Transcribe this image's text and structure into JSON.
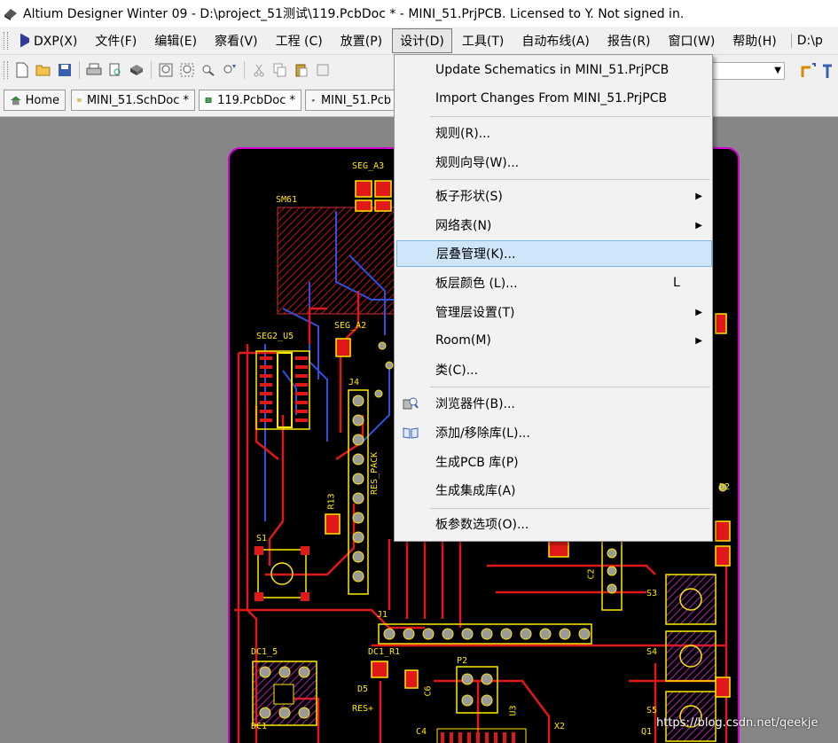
{
  "window": {
    "title": "Altium Designer Winter 09 - D:\\project_51测试\\119.PcbDoc * - MINI_51.PrjPCB. Licensed to Y. Not signed in."
  },
  "menubar": {
    "items": [
      {
        "label": "DXP(X)"
      },
      {
        "label": "文件(F)"
      },
      {
        "label": "编辑(E)"
      },
      {
        "label": "察看(V)"
      },
      {
        "label": "工程 (C)"
      },
      {
        "label": "放置(P)"
      },
      {
        "label": "设计(D)"
      },
      {
        "label": "工具(T)"
      },
      {
        "label": "自动布线(A)"
      },
      {
        "label": "报告(R)"
      },
      {
        "label": "窗口(W)"
      },
      {
        "label": "帮助(H)"
      }
    ],
    "address": "D:\\p"
  },
  "doc_tabs": [
    {
      "label": "Home"
    },
    {
      "label": "MINI_51.SchDoc *"
    },
    {
      "label": "119.PcbDoc *"
    },
    {
      "label": "MINI_51.Pcb"
    }
  ],
  "design_menu": {
    "items": [
      {
        "label": "Update Schematics in MINI_51.PrjPCB"
      },
      {
        "label": "Import Changes From MINI_51.PrjPCB"
      },
      {
        "label": "规则(R)..."
      },
      {
        "label": "规则向导(W)..."
      },
      {
        "label": "板子形状(S)"
      },
      {
        "label": "网络表(N)"
      },
      {
        "label": "层叠管理(K)..."
      },
      {
        "label": "板层颜色 (L)...",
        "shortcut": "L"
      },
      {
        "label": "管理层设置(T)"
      },
      {
        "label": "Room(M)"
      },
      {
        "label": "类(C)..."
      },
      {
        "label": "浏览器件(B)..."
      },
      {
        "label": "添加/移除库(L)..."
      },
      {
        "label": "生成PCB 库(P)"
      },
      {
        "label": "生成集成库(A)"
      },
      {
        "label": "板参数选项(O)..."
      }
    ]
  },
  "pcb_labels": [
    "SEG_A3",
    "SM61",
    "SEG2_U5",
    "SEG_A2",
    "J4",
    "R13",
    "RES_PACK",
    "S1",
    "J1",
    "DC1_5",
    "DC1_R1",
    "D5",
    "C6",
    "RES+",
    "P2",
    "U3",
    "X2",
    "C2",
    "S3",
    "S4",
    "S5",
    "D2",
    "Q1",
    "C4",
    "DC1"
  ],
  "watermark": "https://blog.csdn.net/qeekje"
}
